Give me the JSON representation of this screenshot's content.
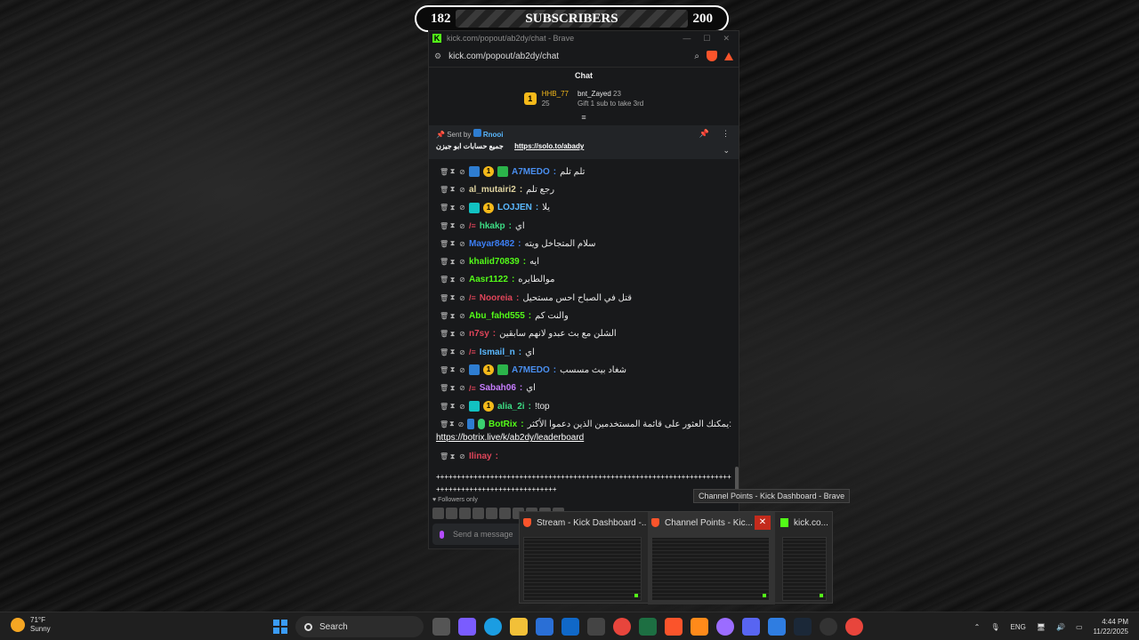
{
  "sub_goal": {
    "current": "182",
    "label": "SUBSCRIBERS",
    "target": "200"
  },
  "browser": {
    "title": "kick.com/popout/ab2dy/chat - Brave",
    "url": "kick.com/popout/ab2dy/chat"
  },
  "chat": {
    "header": "Chat",
    "leaders": [
      {
        "rank": "1",
        "name": "HHB_77",
        "count": "25"
      },
      {
        "name": "bnt_Zayed",
        "count": "23",
        "note": "Gift 1 sub to take 3rd"
      }
    ],
    "pinned": {
      "sent_by": "Sent by",
      "sender": "Rnooi",
      "text": "جميع حسابات ابو جيزن",
      "link": "https://solo.to/abady"
    },
    "messages": [
      {
        "user": "A7MEDO",
        "color": "#4a8ff0",
        "text": "تلم تلم"
      },
      {
        "user": "al_mutairi2",
        "color": "#e0d4a0",
        "text": "رجع تلم"
      },
      {
        "user": "LOJJEN",
        "color": "#5ab8ff",
        "text": "يلا"
      },
      {
        "user": "hkakp",
        "color": "#3ddc84",
        "text": "اي"
      },
      {
        "user": "Mayar8482",
        "color": "#3d7ff5",
        "text": "سلام المتجاخل ويته"
      },
      {
        "user": "khalid70839",
        "color": "#53fc18",
        "text": "ايه"
      },
      {
        "user": "Aasr1122",
        "color": "#53fc18",
        "text": "موالطايره"
      },
      {
        "user": "Nooreia",
        "color": "#e0455a",
        "text": "قتل في الصباح احس مستحيل"
      },
      {
        "user": "Abu_fahd555",
        "color": "#53fc18",
        "text": "والنت كم"
      },
      {
        "user": "n7sy",
        "color": "#e0455a",
        "text": "الشلن مع بث عبدو لانهم سابقين"
      },
      {
        "user": "Ismail_n",
        "color": "#5ab8ff",
        "text": "اي"
      },
      {
        "user": "A7MEDO",
        "color": "#4a8ff0",
        "text": "شغاد بيث مسسب"
      },
      {
        "user": "Sabah06",
        "color": "#c77dff",
        "text": "اي"
      },
      {
        "user": "alia_2i",
        "color": "#3ddc84",
        "text": "!top"
      },
      {
        "user": "BotRix",
        "color": "#53fc18",
        "text": "يمكنك العثور على قائمة المستخدمين الذين دعموا الأكثر:"
      },
      {
        "user": "Ilinay",
        "color": "#e0455a",
        "text": ""
      }
    ],
    "botrix_link": "https://botrix.live/k/ab2dy/leaderboard",
    "long_message": "++++++++++++++++++++++++++++++++++++++++++++++++++++++++++++++++++++++++++++++++++++++++++++++++++++",
    "followers_only": "Followers only",
    "send_placeholder": "Send a message"
  },
  "taskbar_previews": {
    "tooltip": "Channel Points - Kick Dashboard - Brave",
    "items": [
      {
        "title": "Stream - Kick Dashboard -..."
      },
      {
        "title": "Channel Points - Kic..."
      },
      {
        "title": "kick.co..."
      }
    ]
  },
  "taskbar": {
    "weather_temp": "71°F",
    "weather_desc": "Sunny",
    "search": "Search",
    "lang": "ENG",
    "time": "4:44 PM",
    "date": "11/22/2025"
  }
}
